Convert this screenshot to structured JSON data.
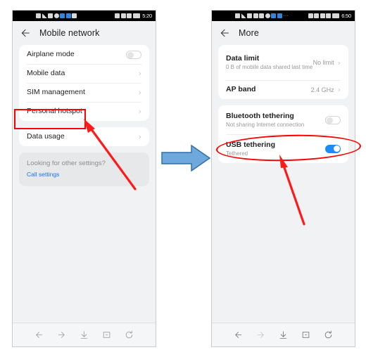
{
  "left_phone": {
    "status_bar": {
      "time": "5:20",
      "left_icons": [
        "sim-icon",
        "signal-bars-icon",
        "wifi-icon",
        "alarm-icon",
        "app-blue-icon",
        "app-blue-2-icon",
        "download-icon"
      ],
      "right_icons": [
        "eye-icon",
        "mute-icon",
        "vibrate-icon",
        "battery-icon"
      ]
    },
    "appbar": {
      "back_icon": "back-arrow-icon",
      "title": "Mobile network"
    },
    "card_one": [
      {
        "label": "Airplane mode",
        "control": "toggle",
        "state": "off"
      },
      {
        "label": "Mobile data",
        "control": "chevron",
        "chevron": "›"
      },
      {
        "label": "SIM management",
        "control": "chevron",
        "chevron": "›"
      },
      {
        "label": "Personal hotspot",
        "control": "chevron",
        "chevron": "›",
        "highlighted": true
      }
    ],
    "card_two": [
      {
        "label": "Data usage",
        "control": "chevron",
        "chevron": "›"
      }
    ],
    "hint": {
      "text": "Looking for other settings?",
      "link": "Call settings"
    },
    "navbar": {
      "items": [
        "back-icon",
        "forward-icon",
        "download-icon",
        "bookmark-icon",
        "refresh-icon"
      ]
    }
  },
  "right_phone": {
    "status_bar": {
      "time": "6:50",
      "left_icons": [
        "sim-icon",
        "signal-bars-icon",
        "wifi-icon",
        "bluetooth-icon",
        "sd-card-icon",
        "alarm-icon",
        "app-blue-icon",
        "app-blue-2-icon",
        "overflow-dots-icon"
      ],
      "right_icons": [
        "eye-icon",
        "mute-icon",
        "location-icon",
        "vibrate-icon",
        "battery-icon"
      ]
    },
    "appbar": {
      "back_icon": "back-arrow-icon",
      "title": "More"
    },
    "card_one": [
      {
        "label": "Data limit",
        "sub": "0 B of mobile data shared last time",
        "value": "No limit",
        "control": "chevron",
        "chevron": "›"
      },
      {
        "label": "AP band",
        "value": "2.4 GHz",
        "control": "chevron",
        "chevron": "›"
      }
    ],
    "card_two": [
      {
        "label": "Bluetooth tethering",
        "sub": "Not sharing Internet connection",
        "control": "toggle",
        "state": "off"
      },
      {
        "label": "USB tethering",
        "sub": "Tethered",
        "control": "toggle",
        "state": "on",
        "highlighted": true
      }
    ],
    "navbar": {
      "items": [
        "back-icon",
        "forward-icon",
        "download-icon",
        "bookmark-icon",
        "refresh-icon"
      ]
    }
  },
  "annotations": {
    "flow_arrow": "blue-right-arrow",
    "left_pointer": "red-arrow-to-personal-hotspot",
    "right_pointer": "red-arrow-to-usb-tethering",
    "highlight_box": "red-rectangle-personal-hotspot",
    "highlight_ellipse": "red-ellipse-usb-tethering"
  },
  "colors": {
    "accent_blue": "#1a8cff",
    "link_blue": "#1a73e8",
    "annotation_red": "#ff0000",
    "flow_arrow_blue": "#6fa8dc",
    "page_bg": "#f1f2f4",
    "card_bg": "#ffffff"
  }
}
